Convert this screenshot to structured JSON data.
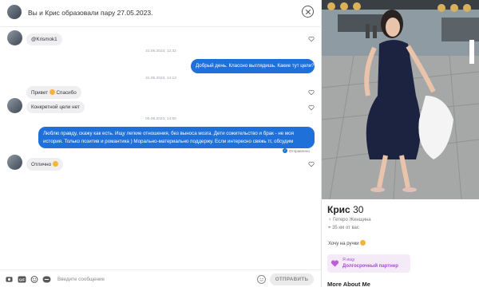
{
  "header": {
    "title": "Вы и Крис образовали пару 27.05.2023."
  },
  "messages": [
    {
      "kind": "in",
      "text": "@Krismok1"
    },
    {
      "kind": "date",
      "text": "31.05.2023, 12:32"
    },
    {
      "kind": "out",
      "text": "Добрый день. Классно выглядишь. Какие тут цели?"
    },
    {
      "kind": "date",
      "text": "31.05.2023, 14:13"
    },
    {
      "kind": "in",
      "text": "Привет",
      "suffix": "Спасибо"
    },
    {
      "kind": "in",
      "text": "Конкретной цели нет"
    },
    {
      "kind": "date",
      "text": "05.06.2023, 14:50"
    },
    {
      "kind": "out",
      "text": "Люблю правду, скажу как есть. Ищу легкие отношения, без выноса мозга. Дети сожительство и брак - не моя история. Только позитив и романтика ) Морально-материально поддержу. Если интересно свяжь тг, обсудим"
    },
    {
      "kind": "in",
      "text": "Отлично"
    }
  ],
  "status": {
    "sent": "Отправлено"
  },
  "composer": {
    "placeholder": "Введите сообщение",
    "send_label": "ОТПРАВИТЬ"
  },
  "profile": {
    "name": "Крис",
    "age": "30",
    "orientation": "Гетеро Женщина",
    "distance": "35 км от вас",
    "about": "Хочу на ручки",
    "looking_for_label": "Я ищу",
    "looking_for_value": "Долгосрочный партнер",
    "more_title": "More About Me"
  },
  "colors": {
    "accent": "#1f70d8",
    "incoming_bubble": "#efeff2",
    "chip_bg": "#f4eaf8",
    "chip_text": "#a64dd0"
  }
}
